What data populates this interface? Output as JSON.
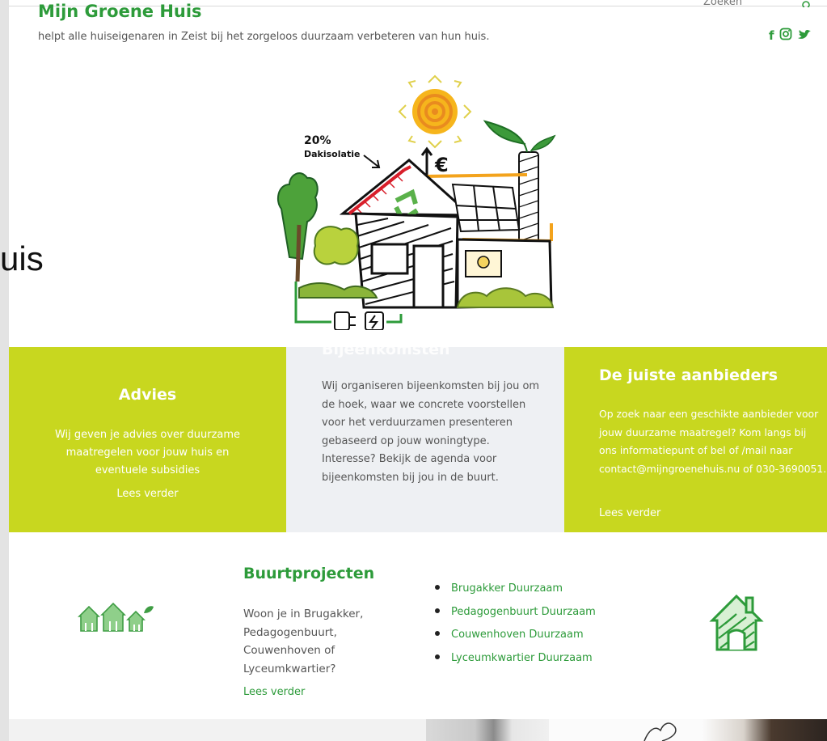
{
  "header": {
    "site_title": "Mijn Groene Huis",
    "tagline": "helpt alle huiseigenaren in Zeist bij het zorgeloos duurzaam verbeteren van hun huis.",
    "search_label": "Zoeken",
    "social": {
      "facebook": "f",
      "instagram_icon": "instagram-icon",
      "twitter_icon": "twitter-icon"
    }
  },
  "background_fragment": "uis",
  "hero": {
    "annotation_line1": "20%",
    "annotation_line2": "Dakisolatie",
    "money_label": "€"
  },
  "panels": {
    "advies": {
      "title": "Advies",
      "text": "Wij geven je advies over duurzame maatregelen voor jouw huis en eventuele subsidies",
      "link": "Lees verder"
    },
    "bijeenkomsten": {
      "title": "Bijeenkomsten",
      "text": "Wij organiseren bijeenkomsten bij jou om de hoek, waar we concrete voorstellen voor het verduurzamen presenteren gebaseerd op jouw woningtype. Interesse? Bekijk de agenda voor bijeenkomsten bij jou in de buurt."
    },
    "aanbieders": {
      "title": "De juiste aanbieders",
      "text": "Op zoek naar een geschikte aanbieder voor jouw duurzame maatregel? Kom langs bij ons informatiepunt of bel of /mail naar contact@mijngroenehuis.nu of 030-3690051.",
      "link": "Lees verder"
    }
  },
  "buurtprojecten": {
    "title": "Buurtprojecten",
    "text": "Woon je in Brugakker, Pedagogenbuurt, Couwenhoven of Lyceumkwartier?",
    "link": "Lees verder",
    "items": [
      "Brugakker Duurzaam",
      "Pedagogenbuurt Duurzaam",
      "Couwenhoven Duurzaam",
      "Lyceumkwartier Duurzaam"
    ]
  },
  "colors": {
    "brand_green": "#2d9b3a",
    "lime": "#c8d71f",
    "panel_grey": "#eef0f3",
    "text": "#555555"
  }
}
